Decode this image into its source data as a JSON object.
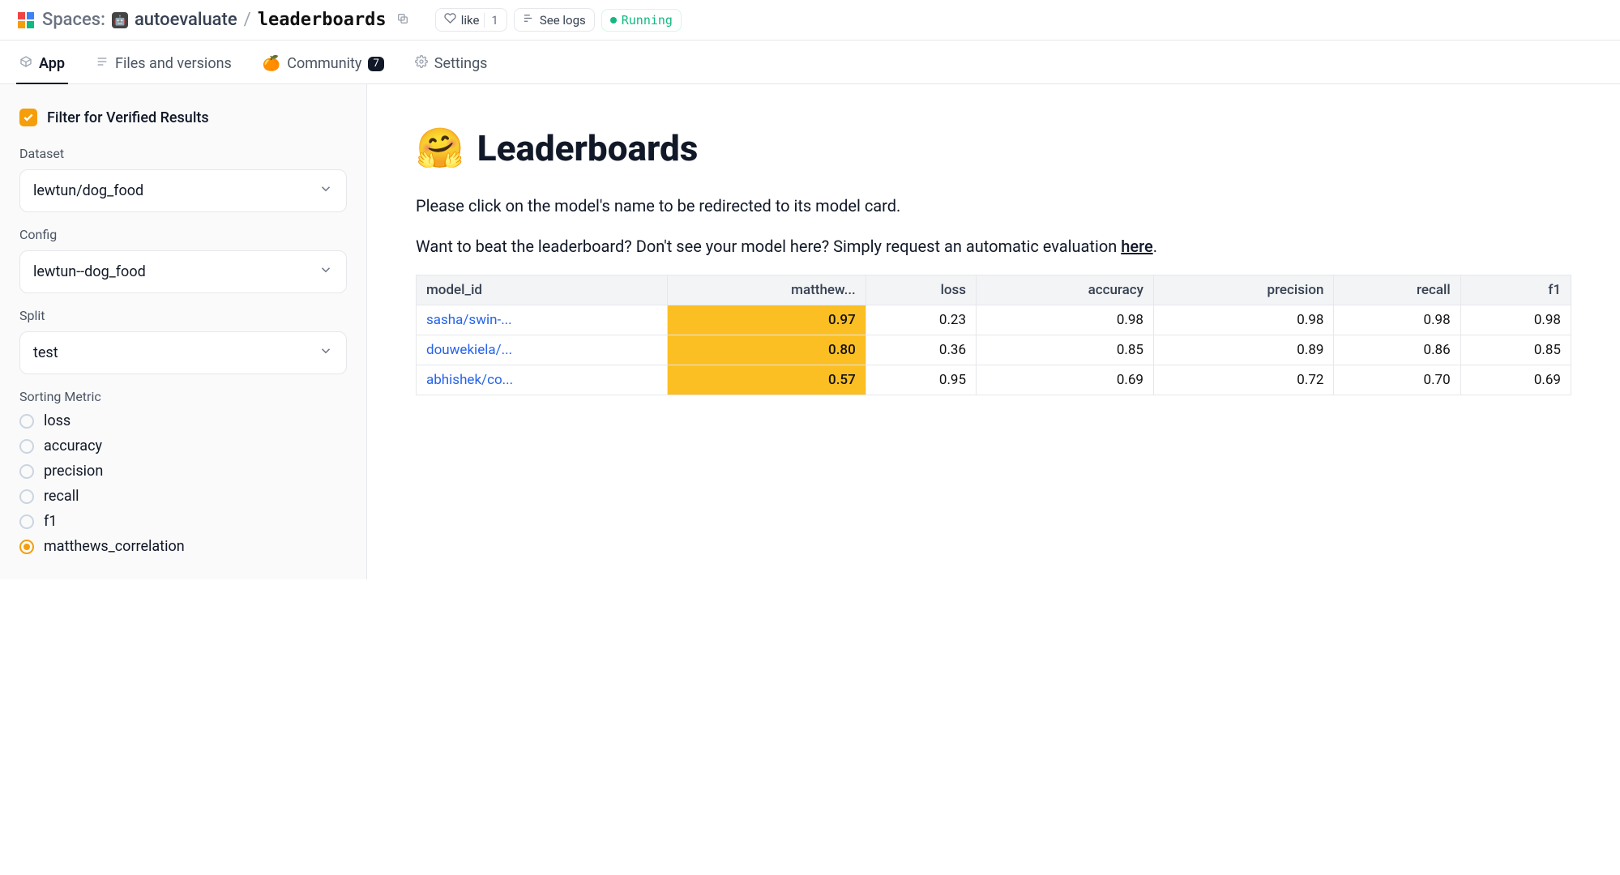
{
  "header": {
    "spaces_label": "Spaces:",
    "owner": "autoevaluate",
    "repo": "leaderboards",
    "like_label": "like",
    "like_count": "1",
    "logs_label": "See logs",
    "running_label": "Running"
  },
  "tabs": {
    "app": "App",
    "files": "Files and versions",
    "community": "Community",
    "community_count": "7",
    "settings": "Settings"
  },
  "sidebar": {
    "filter_label": "Filter for Verified Results",
    "dataset_label": "Dataset",
    "dataset_value": "lewtun/dog_food",
    "config_label": "Config",
    "config_value": "lewtun--dog_food",
    "split_label": "Split",
    "split_value": "test",
    "sorting_label": "Sorting Metric",
    "metrics": [
      {
        "label": "loss",
        "selected": false
      },
      {
        "label": "accuracy",
        "selected": false
      },
      {
        "label": "precision",
        "selected": false
      },
      {
        "label": "recall",
        "selected": false
      },
      {
        "label": "f1",
        "selected": false
      },
      {
        "label": "matthews_correlation",
        "selected": true
      }
    ]
  },
  "main": {
    "emoji": "🤗",
    "title": "Leaderboards",
    "desc1": "Please click on the model's name to be redirected to its model card.",
    "desc2_pre": "Want to beat the leaderboard? Don't see your model here? Simply request an automatic evaluation ",
    "desc2_link": "here",
    "desc2_post": ".",
    "columns": [
      "model_id",
      "matthew...",
      "loss",
      "accuracy",
      "precision",
      "recall",
      "f1"
    ],
    "rows": [
      {
        "model": "sasha/swin-...",
        "mcc": "0.97",
        "loss": "0.23",
        "acc": "0.98",
        "prec": "0.98",
        "rec": "0.98",
        "f1": "0.98"
      },
      {
        "model": "douwekiela/...",
        "mcc": "0.80",
        "loss": "0.36",
        "acc": "0.85",
        "prec": "0.89",
        "rec": "0.86",
        "f1": "0.85"
      },
      {
        "model": "abhishek/co...",
        "mcc": "0.57",
        "loss": "0.95",
        "acc": "0.69",
        "prec": "0.72",
        "rec": "0.70",
        "f1": "0.69"
      }
    ]
  }
}
